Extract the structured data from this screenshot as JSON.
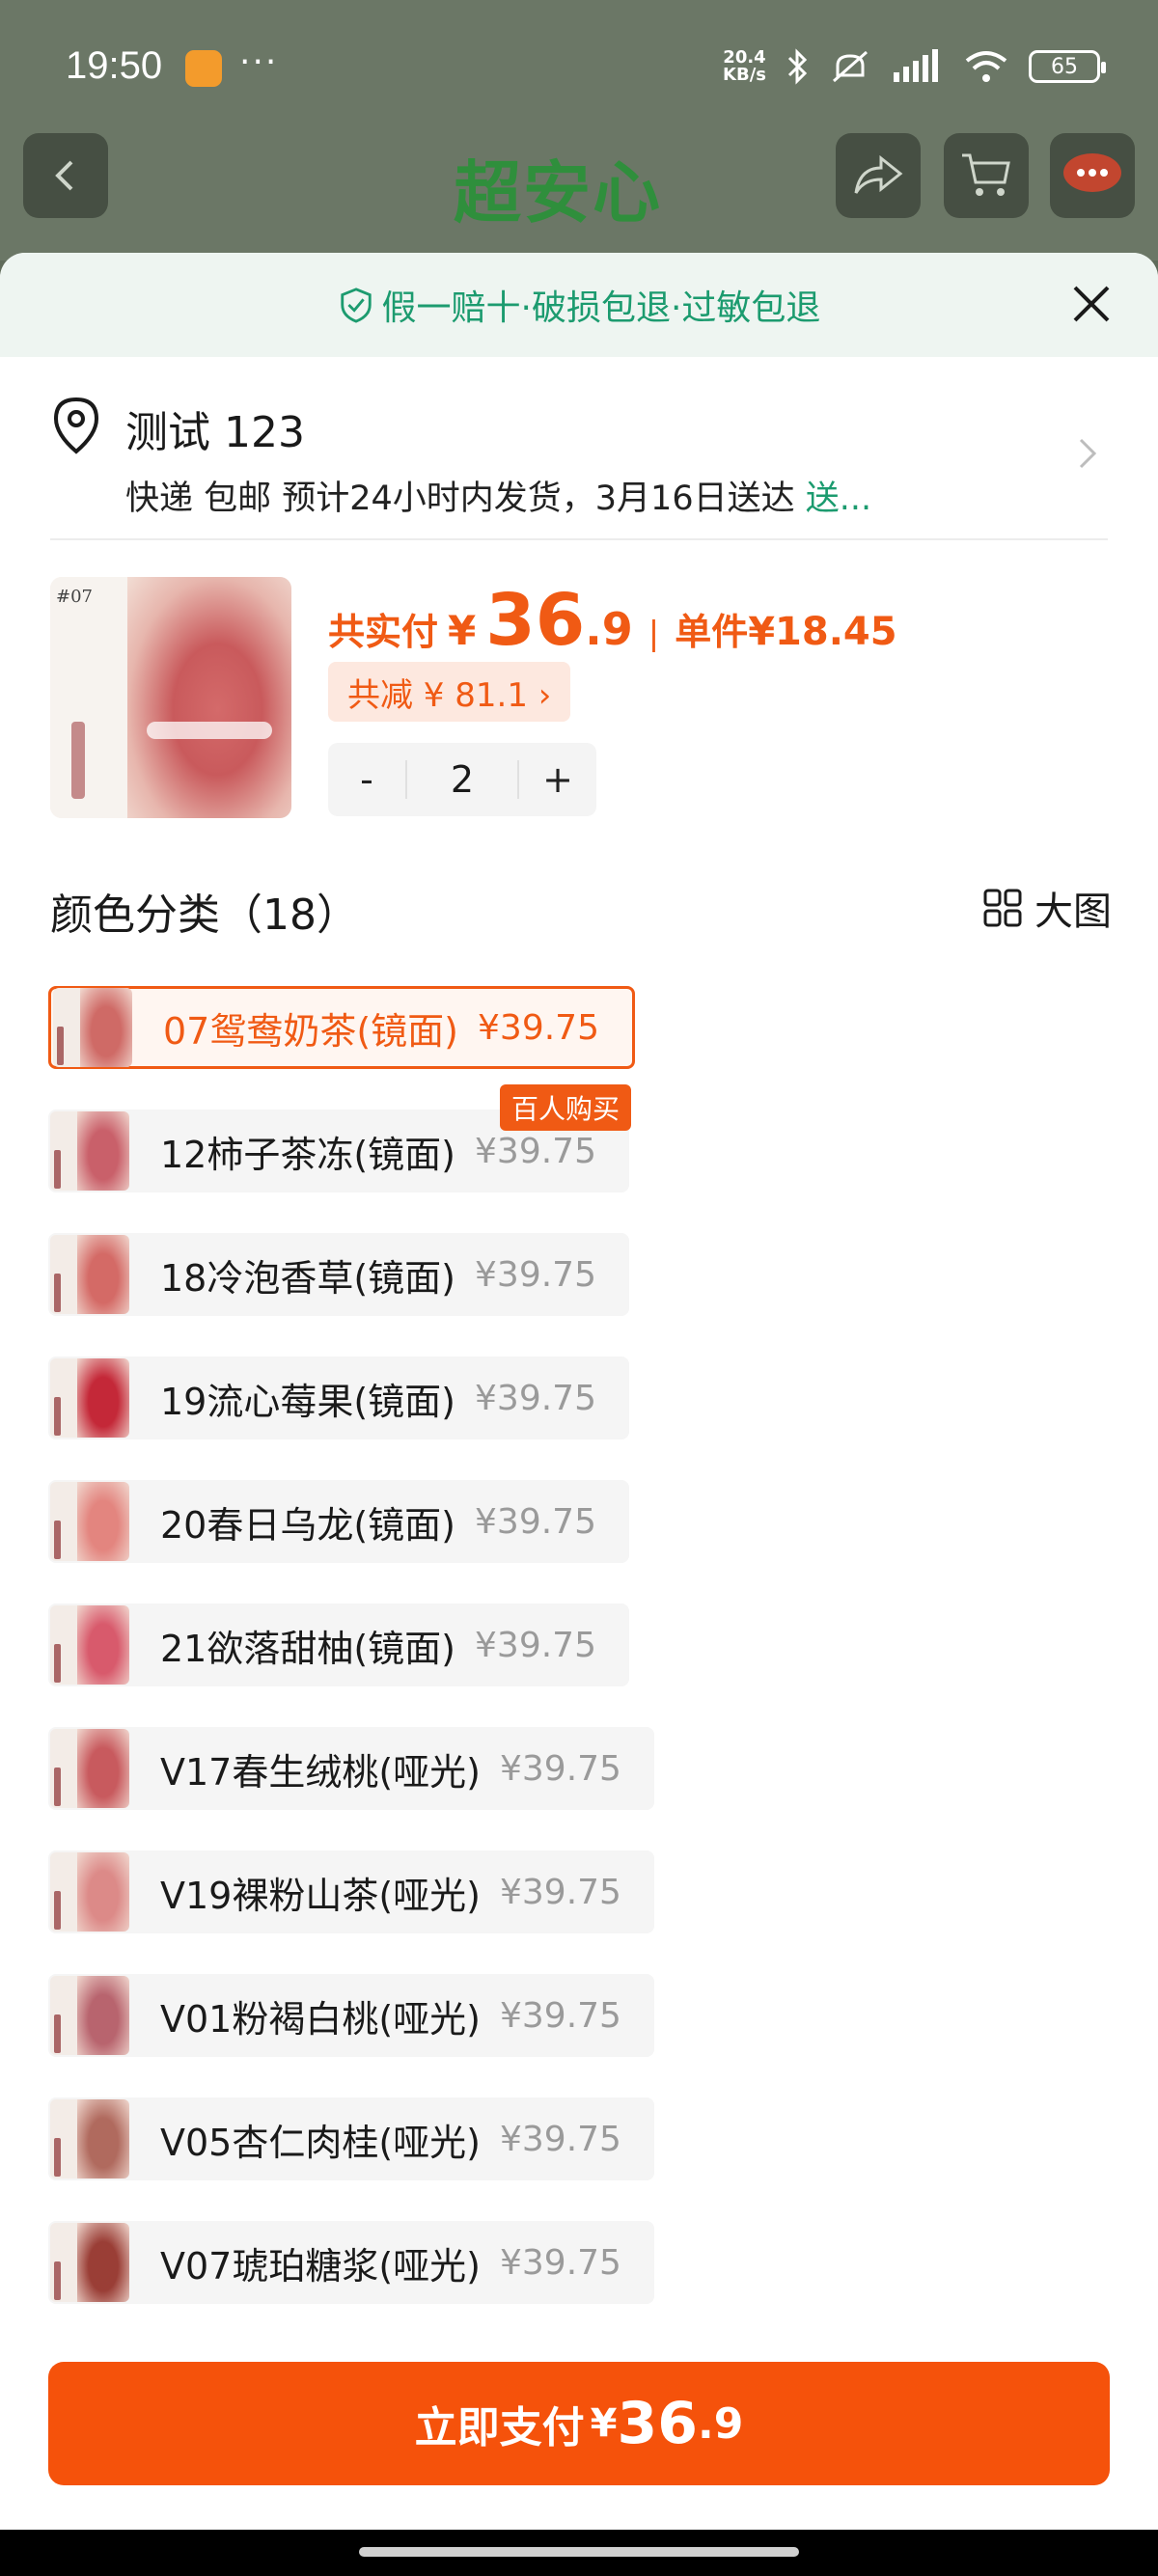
{
  "statusbar": {
    "time": "19:50",
    "dots": "···",
    "net_speed_top": "20.4",
    "net_speed_bottom": "KB/s",
    "battery": "65"
  },
  "navbar": {
    "title": "超安心"
  },
  "guarantee": {
    "text": "假一赔十·破损包退·过敏包退"
  },
  "address": {
    "name": "测试 123",
    "detail": "快递 包邮 预计24小时内发货，3月16日送达",
    "more": "送..."
  },
  "product": {
    "thumb_num": "#07",
    "pay_label": "共实付",
    "yen": "¥",
    "pay_int": "36",
    "pay_dec": ".9",
    "separator": "|",
    "unit_label": "单件",
    "unit_price": "¥18.45",
    "discount": "共减 ¥ 81.1 ›",
    "qty": "2",
    "minus": "-",
    "plus": "+"
  },
  "colors": {
    "title": "颜色分类（18）",
    "big_image_label": "大图",
    "hot_badge": "百人购买",
    "items": [
      {
        "name": "07鸳鸯奶茶(镜面)",
        "price": "¥39.75",
        "lip": "#cf6a66"
      },
      {
        "name": "12柿子茶冻(镜面)",
        "price": "¥39.75",
        "lip": "#c9606a"
      },
      {
        "name": "18冷泡香草(镜面)",
        "price": "¥39.75",
        "lip": "#d46a66"
      },
      {
        "name": "19流心莓果(镜面)",
        "price": "¥39.75",
        "lip": "#c42838"
      },
      {
        "name": "20春日乌龙(镜面)",
        "price": "¥39.75",
        "lip": "#e3857f"
      },
      {
        "name": "21欲落甜柚(镜面)",
        "price": "¥39.75",
        "lip": "#d85a6c"
      },
      {
        "name": "V17春生绒桃(哑光)",
        "price": "¥39.75",
        "lip": "#c85a5e"
      },
      {
        "name": "V19裸粉山茶(哑光)",
        "price": "¥39.75",
        "lip": "#dc8a88"
      },
      {
        "name": "V01粉褐白桃(哑光)",
        "price": "¥39.75",
        "lip": "#b8646e"
      },
      {
        "name": "V05杏仁肉桂(哑光)",
        "price": "¥39.75",
        "lip": "#b06a5e"
      },
      {
        "name": "V07琥珀糖浆(哑光)",
        "price": "¥39.75",
        "lip": "#9a3e36"
      }
    ]
  },
  "pay_button": {
    "label": "立即支付",
    "yen": "¥",
    "int": "36",
    "dec": ".9"
  },
  "theme": {
    "accent": "#f05a14",
    "green": "#1c9b6f"
  }
}
